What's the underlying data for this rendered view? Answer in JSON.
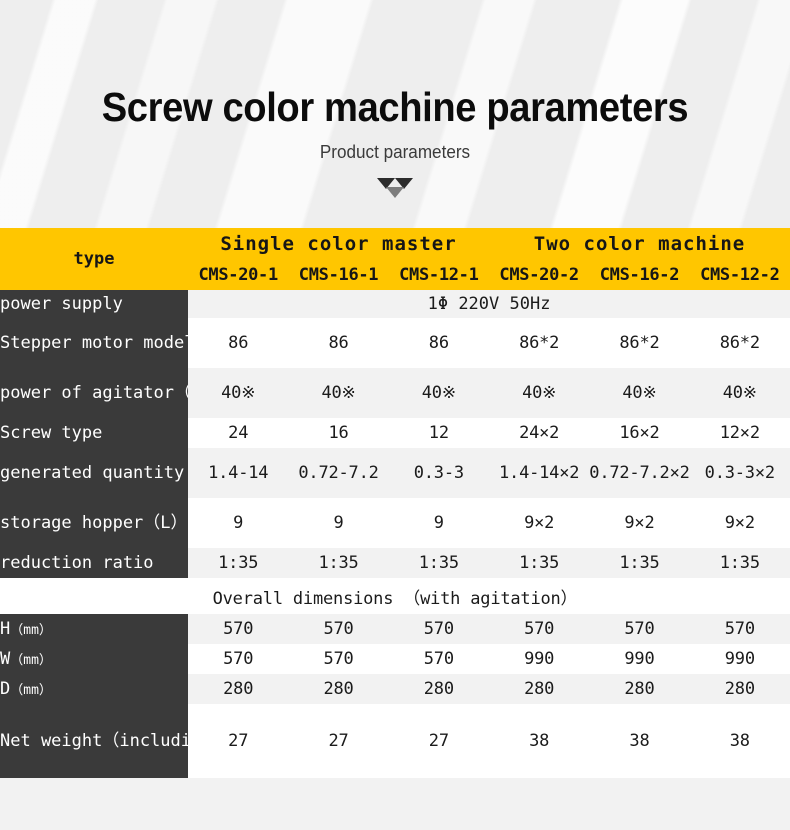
{
  "hero": {
    "title": "Screw color machine parameters",
    "subtitle": "Product parameters",
    "arrow_icon": "triple-down-triangle"
  },
  "table": {
    "corner_label": "type",
    "groups": [
      {
        "label": "Single color master",
        "span": 3
      },
      {
        "label": "Two color machine",
        "span": 3
      }
    ],
    "models": [
      "CMS-20-1",
      "CMS-16-1",
      "CMS-12-1",
      "CMS-20-2",
      "CMS-16-2",
      "CMS-12-2"
    ],
    "rows": [
      {
        "label": "power supply",
        "label_suffix": "",
        "merged": true,
        "merged_value": "1Φ 220V 50Hz",
        "values": []
      },
      {
        "label": "Stepper motor model",
        "merged": false,
        "values": [
          "86",
          "86",
          "86",
          "86*2",
          "86*2",
          "86*2"
        ]
      },
      {
        "label": "power of agitator（W）",
        "merged": false,
        "values": [
          "40※",
          "40※",
          "40※",
          "40※",
          "40※",
          "40※"
        ]
      },
      {
        "label": "Screw type",
        "merged": false,
        "values": [
          "24",
          "16",
          "12",
          "24×2",
          "16×2",
          "12×2"
        ]
      },
      {
        "label": "generated quantity（kg/h）",
        "merged": false,
        "values": [
          "1.4-14",
          "0.72-7.2",
          "0.3-3",
          "1.4-14×2",
          "0.72-7.2×2",
          "0.3-3×2"
        ]
      },
      {
        "label": "storage hopper（L）",
        "merged": false,
        "values": [
          "9",
          "9",
          "9",
          "9×2",
          "9×2",
          "9×2"
        ]
      },
      {
        "label": "reduction ratio",
        "merged": false,
        "values": [
          "1:35",
          "1:35",
          "1:35",
          "1:35",
          "1:35",
          "1:35"
        ]
      }
    ],
    "section_title": "Overall dimensions （with agitation）",
    "dimension_rows": [
      {
        "label": "H",
        "label_unit": "（mm）",
        "values": [
          "570",
          "570",
          "570",
          "570",
          "570",
          "570"
        ]
      },
      {
        "label": "W",
        "label_unit": "（mm）",
        "values": [
          "570",
          "570",
          "570",
          "990",
          "990",
          "990"
        ]
      },
      {
        "label": "D",
        "label_unit": "（mm）",
        "values": [
          "280",
          "280",
          "280",
          "280",
          "280",
          "280"
        ]
      }
    ],
    "weight_row": {
      "label": "Net weight（including electric box）kg",
      "values": [
        "27",
        "27",
        "27",
        "38",
        "38",
        "38"
      ]
    }
  },
  "colors": {
    "header_yellow": "#ffc600",
    "label_dark": "#3a3a3a",
    "row_gray": "#f2f2f2",
    "row_white": "#ffffff",
    "text_dark": "#1b1b1b"
  }
}
